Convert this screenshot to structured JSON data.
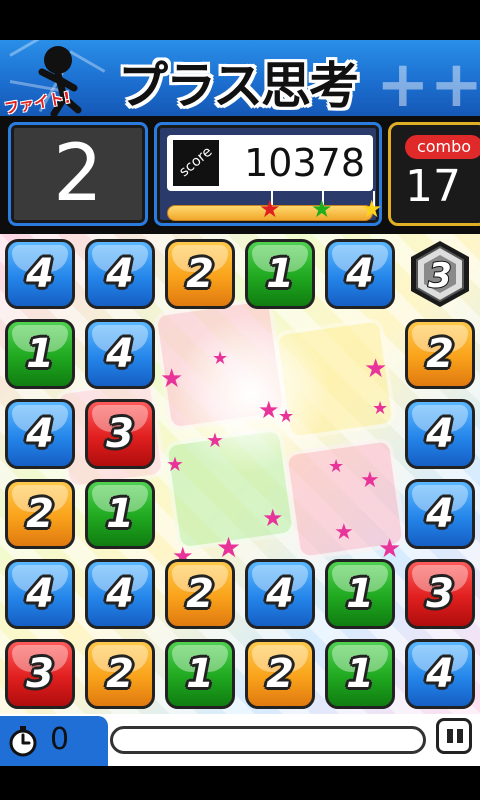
{
  "banner": {
    "fight_text": "ファイト!",
    "title": "プラス思考",
    "plus_symbols": "++"
  },
  "hud": {
    "moves": "2",
    "score_label": "score",
    "score": "10378",
    "combo_label": "combo",
    "combo": "17",
    "stars": [
      "red",
      "green",
      "yellow"
    ]
  },
  "board": {
    "rows": [
      [
        "4",
        "4",
        "2",
        "1",
        "4",
        "3"
      ],
      [
        "1",
        "4",
        "",
        "",
        "",
        "2"
      ],
      [
        "4",
        "3",
        "",
        "",
        "",
        "4"
      ],
      [
        "2",
        "1",
        "",
        "",
        "",
        "4"
      ],
      [
        "4",
        "4",
        "2",
        "4",
        "1",
        "3"
      ],
      [
        "3",
        "2",
        "1",
        "2",
        "1",
        "4"
      ]
    ],
    "special_tile": "hexagon-3",
    "colors": {
      "1": "#1fa81f",
      "2": "#f9a21a",
      "3": "#e01f1f",
      "4": "#2586ea"
    }
  },
  "footer": {
    "timer": "0",
    "progress_fraction": 0.0
  }
}
